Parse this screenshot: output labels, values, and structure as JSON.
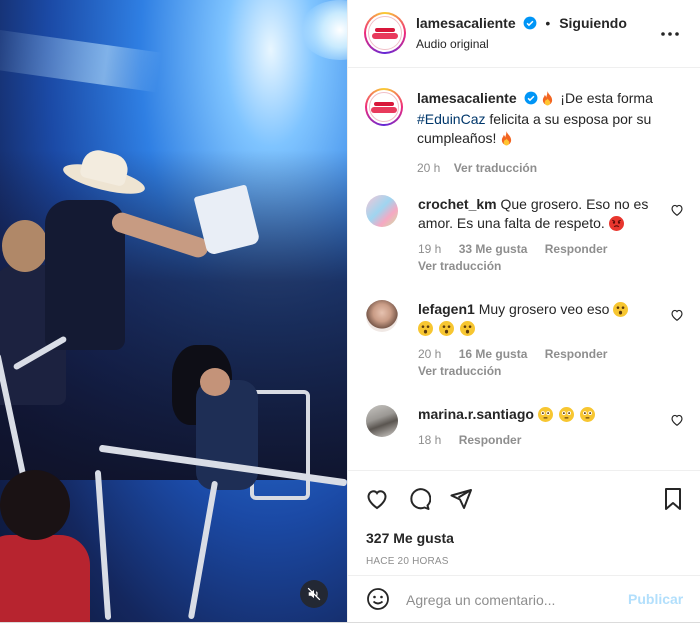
{
  "post": {
    "username": "lamesacaliente",
    "follow_status": "Siguiendo",
    "audio": "Audio original",
    "more_icon": "more-options-icon",
    "verified_color": "#0095f6"
  },
  "caption": {
    "username": "lamesacaliente",
    "text_before": "¡De esta forma",
    "hashtag": "#EduinCaz",
    "text_after": "felicita a su esposa por su cumpleaños!",
    "time": "20 h",
    "translate": "Ver traducción"
  },
  "comments": [
    {
      "username": "crochet_km",
      "text": "Que grosero. Eso no es amor. Es una falta de respeto.",
      "emoji": "angry-face",
      "time": "19 h",
      "likes": "33 Me gusta",
      "reply": "Responder",
      "translate": "Ver traducción"
    },
    {
      "username": "lefagen1",
      "text": "Muy grosero veo eso",
      "emoji": "astonished-face x4",
      "time": "20 h",
      "likes": "16 Me gusta",
      "reply": "Responder",
      "translate": "Ver traducción"
    },
    {
      "username": "marina.r.santiago",
      "text": "",
      "emoji": "flushed-face x3",
      "time": "18 h",
      "reply": "Responder"
    }
  ],
  "actions": {
    "likes": "327 Me gusta",
    "time_ago": "HACE 20 HORAS",
    "comment_placeholder": "Agrega un comentario...",
    "publish": "Publicar"
  },
  "colors": {
    "text": "#262626",
    "secondary": "#8e8e8e",
    "link": "#00376b",
    "publish_disabled": "#b2dffc"
  }
}
